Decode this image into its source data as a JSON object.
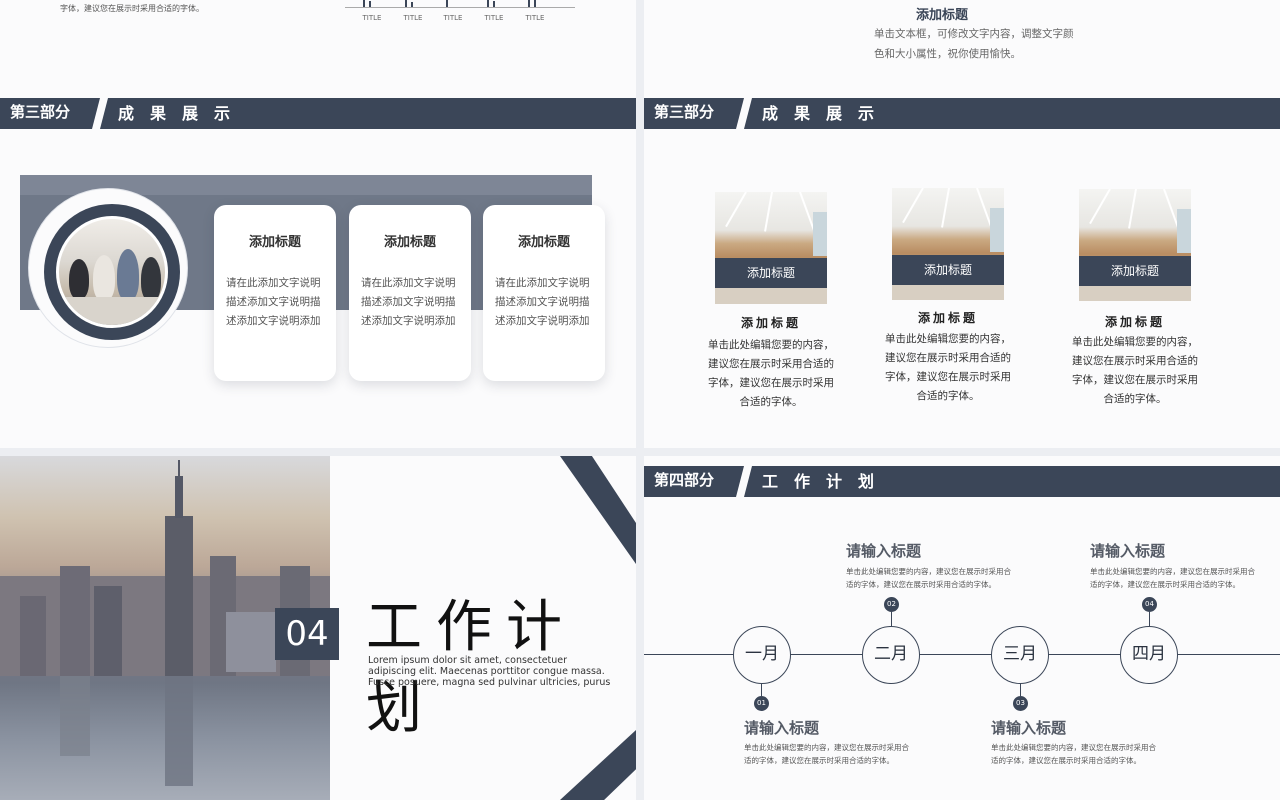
{
  "slide1": {
    "fragment_text": "字体，建议您在展示时采用合适的字体。",
    "tick_labels": [
      "TITLE",
      "TITLE",
      "TITLE",
      "TITLE",
      "TITLE"
    ]
  },
  "slide2": {
    "title": "添加标题",
    "body": "单击文本框，可修改文字内容，调整文字颜色和大小属性，祝你使用愉快。"
  },
  "slide3": {
    "section_num": "第三部分",
    "section_title": "成果展示",
    "cards": [
      {
        "title": "添加标题",
        "body": "请在此添加文字说明描述添加文字说明描述添加文字说明添加"
      },
      {
        "title": "添加标题",
        "body": "请在此添加文字说明描述添加文字说明描述添加文字说明添加"
      },
      {
        "title": "添加标题",
        "body": "请在此添加文字说明描述添加文字说明描述添加文字说明添加"
      }
    ]
  },
  "slide4": {
    "section_num": "第三部分",
    "section_title": "成果展示",
    "items": [
      {
        "label": "添加标题",
        "title": "添加标题",
        "body": "单击此处编辑您要的内容，建议您在展示时采用合适的字体，建议您在展示时采用合适的字体。"
      },
      {
        "label": "添加标题",
        "title": "添加标题",
        "body": "单击此处编辑您要的内容，建议您在展示时采用合适的字体，建议您在展示时采用合适的字体。"
      },
      {
        "label": "添加标题",
        "title": "添加标题",
        "body": "单击此处编辑您要的内容，建议您在展示时采用合适的字体，建议您在展示时采用合适的字体。"
      }
    ]
  },
  "slide5": {
    "number": "04",
    "title": "工作计划",
    "lorem": "Lorem ipsum dolor sit amet, consectetuer adipiscing elit. Maecenas porttitor congue massa. Fusce posuere, magna sed pulvinar ultricies, purus"
  },
  "slide6": {
    "section_num": "第四部分",
    "section_title": "工作计划",
    "months": [
      "一月",
      "二月",
      "三月",
      "四月"
    ],
    "events": [
      {
        "num": "01",
        "title": "请输入标题",
        "body": "单击此处编辑您要的内容，建议您在展示时采用合适的字体，建议您在展示时采用合适的字体。"
      },
      {
        "num": "02",
        "title": "请输入标题",
        "body": "单击此处编辑您要的内容，建议您在展示时采用合适的字体，建议您在展示时采用合适的字体。"
      },
      {
        "num": "03",
        "title": "请输入标题",
        "body": "单击此处编辑您要的内容，建议您在展示时采用合适的字体，建议您在展示时采用合适的字体。"
      },
      {
        "num": "04",
        "title": "请输入标题",
        "body": "单击此处编辑您要的内容，建议您在展示时采用合适的字体，建议您在展示时采用合适的字体。"
      }
    ]
  },
  "colors": {
    "accent": "#3b4658",
    "band": "#6f7888",
    "background": "#fbfbfc"
  }
}
